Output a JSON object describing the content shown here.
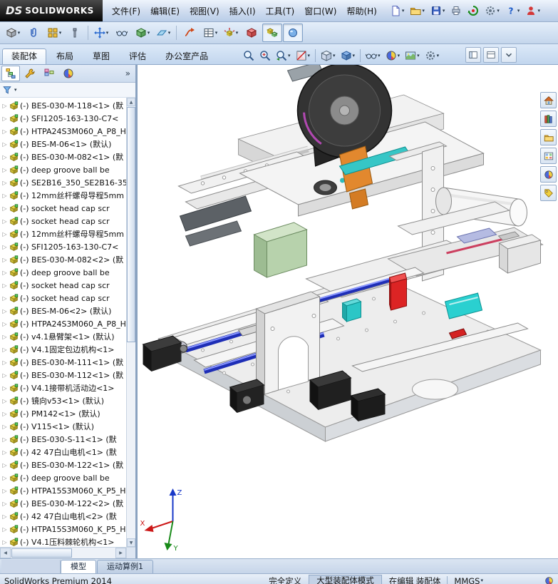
{
  "titlebar": {
    "logo_mark": "DS",
    "logo_text": "SOLIDWORKS",
    "menus": [
      {
        "key": "file",
        "label": "文件(F)"
      },
      {
        "key": "edit",
        "label": "编辑(E)"
      },
      {
        "key": "view",
        "label": "视图(V)"
      },
      {
        "key": "insert",
        "label": "插入(I)"
      },
      {
        "key": "tools",
        "label": "工具(T)"
      },
      {
        "key": "window",
        "label": "窗口(W)"
      },
      {
        "key": "help",
        "label": "帮助(H)"
      }
    ],
    "quick_icons": [
      {
        "name": "new-document",
        "kind": "page",
        "caret": true
      },
      {
        "name": "open",
        "kind": "folder",
        "caret": true
      },
      {
        "name": "save",
        "kind": "disk",
        "caret": true
      },
      {
        "name": "print",
        "kind": "print",
        "caret": false
      },
      {
        "name": "rebuild",
        "kind": "rebuild",
        "caret": false
      },
      {
        "name": "options",
        "kind": "gear",
        "caret": true
      },
      {
        "name": "help",
        "kind": "question",
        "caret": true
      },
      {
        "name": "user-login",
        "kind": "user",
        "caret": true
      }
    ]
  },
  "toolbar": {
    "icons": [
      {
        "name": "insert-components",
        "kind": "cube-gray",
        "caret": true
      },
      {
        "name": "mate",
        "kind": "clip",
        "caret": false
      },
      {
        "name": "linear-component-pattern",
        "kind": "grid",
        "caret": true
      },
      {
        "name": "smart-fasteners",
        "kind": "bolt",
        "caret": false
      },
      {
        "sep": true
      },
      {
        "name": "move-component",
        "kind": "move",
        "caret": true
      },
      {
        "name": "show-hidden-components",
        "kind": "glasses",
        "caret": false
      },
      {
        "name": "assembly-features",
        "kind": "cube-green",
        "caret": true
      },
      {
        "name": "reference-geometry",
        "kind": "plane",
        "caret": true
      },
      {
        "sep": true
      },
      {
        "name": "new-motion-study",
        "kind": "motion",
        "caret": false
      },
      {
        "name": "bill-of-materials",
        "kind": "bom",
        "caret": true
      },
      {
        "name": "exploded-view",
        "kind": "explode",
        "caret": true
      },
      {
        "name": "interference-detection",
        "kind": "cube-red",
        "caret": false
      },
      {
        "name": "large-assembly-mode",
        "kind": "cubes",
        "caret": false,
        "active": true
      },
      {
        "name": "instant3d",
        "kind": "sphere",
        "caret": false,
        "active": true
      }
    ]
  },
  "command_tabs": [
    {
      "key": "assembly",
      "label": "装配体",
      "active": true
    },
    {
      "key": "layout",
      "label": "布局",
      "active": false
    },
    {
      "key": "sketch",
      "label": "草图",
      "active": false
    },
    {
      "key": "evaluate",
      "label": "评估",
      "active": false
    },
    {
      "key": "office-products",
      "label": "办公室产品",
      "active": false
    }
  ],
  "headsup": [
    {
      "name": "zoom-to-fit",
      "kind": "magnifier",
      "caret": false
    },
    {
      "name": "zoom-to-area",
      "kind": "magnifier-plus",
      "caret": false
    },
    {
      "name": "previous-view",
      "kind": "magnifier-back",
      "caret": true
    },
    {
      "name": "section-view",
      "kind": "section",
      "caret": true
    },
    {
      "sep": true
    },
    {
      "name": "view-orientation",
      "kind": "viewbox",
      "caret": true
    },
    {
      "name": "display-style",
      "kind": "shaded",
      "caret": true
    },
    {
      "sep": true
    },
    {
      "name": "hide-show-items",
      "kind": "glasses",
      "caret": true
    },
    {
      "name": "edit-appearance",
      "kind": "ball",
      "caret": true
    },
    {
      "name": "apply-scene",
      "kind": "scene",
      "caret": true
    },
    {
      "name": "view-settings",
      "kind": "gear",
      "caret": true
    }
  ],
  "pane_buttons": [
    {
      "name": "toggle-left-pane",
      "kind": "winpane"
    },
    {
      "name": "toggle-split-pane",
      "kind": "winpane2"
    },
    {
      "name": "collapse-ribbon",
      "kind": "carettool"
    }
  ],
  "left_panel": {
    "overflow": "»",
    "tabs": [
      {
        "name": "featuremanager-tree",
        "kind": "tree",
        "active": true
      },
      {
        "name": "propertymanager",
        "kind": "wrench",
        "active": false
      },
      {
        "name": "configurationmanager",
        "kind": "configs",
        "active": false
      },
      {
        "name": "displaymanager",
        "kind": "ball",
        "active": false
      }
    ],
    "filter": {
      "name": "filter",
      "kind": "funnel"
    }
  },
  "feature_tree": {
    "items": [
      "(-) BES-030-M-118<1> (默",
      "(-) SFI1205-163-130-C7<",
      "(-) HTPA24S3M060_A_P8_H",
      "(-) BES-M-06<1> (默认)",
      "(-) BES-030-M-082<1> (默",
      "(-) deep groove ball be",
      "(-) SE2B16_350_SE2B16-35",
      "(-) 12mm丝杆螺母导程5mm",
      "(-) socket head cap scr",
      "(-) socket head cap scr",
      "(-) 12mm丝杆螺母导程5mm",
      "(-) SFI1205-163-130-C7<",
      "(-) BES-030-M-082<2> (默",
      "(-) deep groove ball be",
      "(-) socket head cap scr",
      "(-) socket head cap scr",
      "(-) BES-M-06<2> (默认)",
      "(-) HTPA24S3M060_A_P8_H",
      "(-) v4.1悬臂架<1> (默认)",
      "(-) V4.1固定包边机构<1>",
      "(-) BES-030-M-111<1> (默",
      "(-) BES-030-M-112<1> (默",
      "(-) V4.1接带机活动边<1>",
      "(-) 镜向v53<1> (默认)",
      "(-) PM142<1> (默认)",
      "(-) V115<1> (默认)",
      "(-) BES-030-S-11<1> (默",
      "(-) 42 47白山电机<1> (默",
      "(-) BES-030-M-122<1> (默",
      "(-) deep groove ball be",
      "(-) HTPA15S3M060_K_P5_H",
      "(-) BES-030-M-122<2> (默",
      "(-) 42 47白山电机<2> (默",
      "(-) HTPA15S3M060_K_P5_H",
      "(-) V4.1压料棘轮机构<1>"
    ]
  },
  "task_pane": [
    {
      "name": "solidworks-resources",
      "kind": "home"
    },
    {
      "name": "design-library",
      "kind": "books"
    },
    {
      "name": "file-explorer",
      "kind": "folder"
    },
    {
      "name": "view-palette",
      "kind": "palette"
    },
    {
      "name": "appearances-scenes",
      "kind": "ball"
    },
    {
      "name": "custom-properties",
      "kind": "tag"
    }
  ],
  "bottom_tabs": [
    {
      "key": "model",
      "label": "模型",
      "active": true
    },
    {
      "key": "motion-study-1",
      "label": "运动算例1",
      "active": false
    }
  ],
  "status_bar": {
    "product": "SolidWorks Premium 2014",
    "state": "完全定义",
    "mode": "大型装配体模式",
    "editing": "在编辑 装配体",
    "units": "MMGS"
  },
  "viewport": {
    "triad": {
      "x": "X",
      "y": "Y",
      "z": "Z"
    }
  }
}
